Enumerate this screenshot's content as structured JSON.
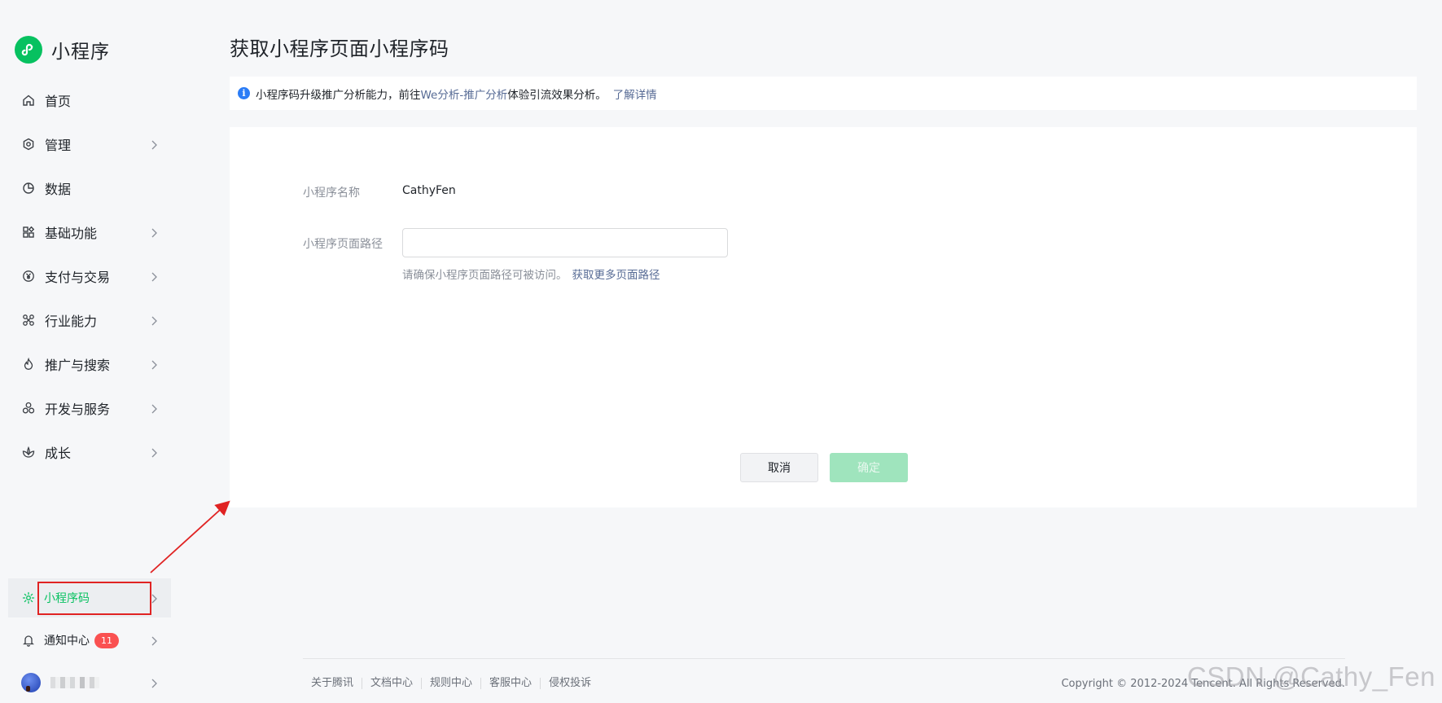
{
  "brand": {
    "name": "小程序",
    "logo_icon": "miniprogram-logo-icon",
    "color": "#07c160"
  },
  "sidebar": {
    "items": [
      {
        "label": "首页",
        "icon": "home-icon",
        "chevron": false
      },
      {
        "label": "管理",
        "icon": "hexagon-settings-icon",
        "chevron": true
      },
      {
        "label": "数据",
        "icon": "pie-chart-icon",
        "chevron": false
      },
      {
        "label": "基础功能",
        "icon": "grid-apps-icon",
        "chevron": true
      },
      {
        "label": "支付与交易",
        "icon": "yuan-coin-icon",
        "chevron": true
      },
      {
        "label": "行业能力",
        "icon": "nodes-icon",
        "chevron": true
      },
      {
        "label": "推广与搜索",
        "icon": "flame-icon",
        "chevron": true
      },
      {
        "label": "开发与服务",
        "icon": "circles-icon",
        "chevron": true
      },
      {
        "label": "成长",
        "icon": "lotus-icon",
        "chevron": true
      }
    ],
    "bottom": {
      "qrcode": {
        "label": "小程序码",
        "icon": "sun-code-icon",
        "active": true
      },
      "notify": {
        "label": "通知中心",
        "badge": "11",
        "icon": "bell-icon"
      }
    }
  },
  "page": {
    "title": "获取小程序页面小程序码"
  },
  "notice": {
    "text_before": "小程序码升级推广分析能力，前往",
    "link": "We分析-推广分析",
    "text_after": "体验引流效果分析。",
    "more_link": "了解详情"
  },
  "form": {
    "name_label": "小程序名称",
    "name_value": "CathyFen",
    "path_label": "小程序页面路径",
    "path_value": "",
    "path_placeholder": "",
    "hint_text": "请确保小程序页面路径可被访问。",
    "hint_link": "获取更多页面路径",
    "cancel_label": "取消",
    "confirm_label": "确定"
  },
  "footer": {
    "links": [
      "关于腾讯",
      "文档中心",
      "规则中心",
      "客服中心",
      "侵权投诉"
    ],
    "copyright": "Copyright © 2012-2024 Tencent. All Rights Reserved."
  },
  "watermark": "CSDN @Cathy_Fen",
  "colors": {
    "accent": "#07c160",
    "link": "#576b95",
    "highlight": "#e02323",
    "badge": "#fa5151"
  }
}
